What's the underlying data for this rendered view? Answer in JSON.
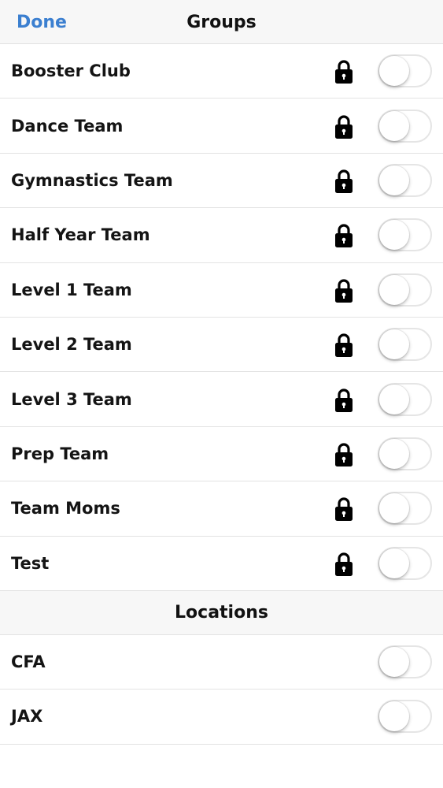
{
  "navbar": {
    "done_label": "Done",
    "title": "Groups"
  },
  "groups": [
    {
      "label": "Booster Club",
      "locked": true,
      "enabled": false
    },
    {
      "label": "Dance Team",
      "locked": true,
      "enabled": false
    },
    {
      "label": "Gymnastics Team",
      "locked": true,
      "enabled": false
    },
    {
      "label": "Half Year Team",
      "locked": true,
      "enabled": false
    },
    {
      "label": "Level 1 Team",
      "locked": true,
      "enabled": false
    },
    {
      "label": "Level 2 Team",
      "locked": true,
      "enabled": false
    },
    {
      "label": "Level 3 Team",
      "locked": true,
      "enabled": false
    },
    {
      "label": "Prep Team",
      "locked": true,
      "enabled": false
    },
    {
      "label": "Team Moms",
      "locked": true,
      "enabled": false
    },
    {
      "label": "Test",
      "locked": true,
      "enabled": false
    }
  ],
  "locations_header": "Locations",
  "locations": [
    {
      "label": "CFA",
      "enabled": false
    },
    {
      "label": "JAX",
      "enabled": false
    }
  ],
  "icons": {
    "lock": "lock-icon"
  },
  "colors": {
    "accent": "#3b7fd0",
    "header_bg": "#f7f7f7"
  }
}
